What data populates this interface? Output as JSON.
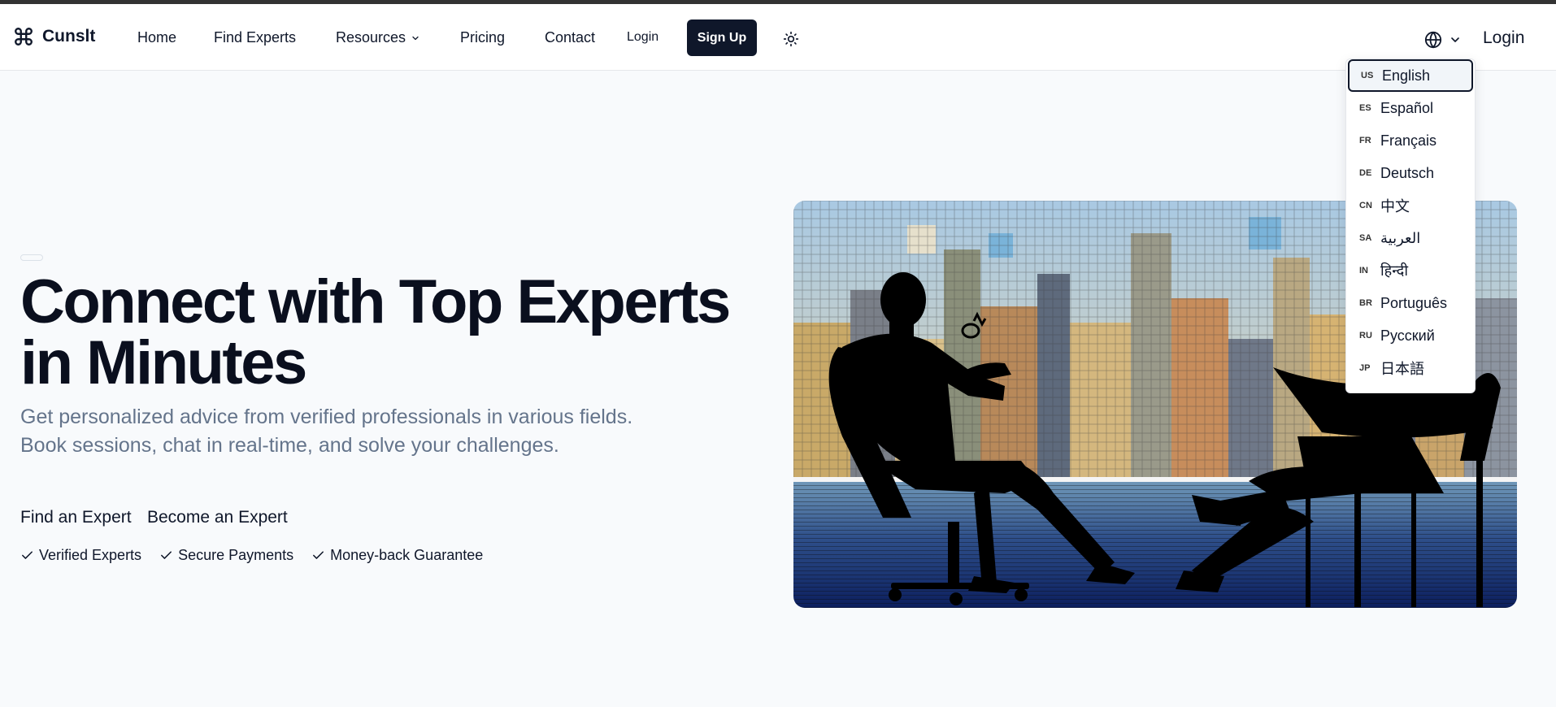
{
  "brand": {
    "name": "Cunslt",
    "logo_icon": "command-icon"
  },
  "nav": {
    "links": [
      {
        "label": "Home"
      },
      {
        "label": "Find Experts"
      },
      {
        "label": "Resources",
        "icon": "chevron-down-icon"
      },
      {
        "label": "Pricing"
      },
      {
        "label": "Contact"
      }
    ],
    "login_small": "Login",
    "signup": "Sign Up",
    "theme_icon": "sun-icon",
    "language_icon": "globe-icon",
    "login_right": "Login"
  },
  "language_menu": {
    "items": [
      {
        "code": "US",
        "label": "English",
        "selected": true
      },
      {
        "code": "ES",
        "label": "Español"
      },
      {
        "code": "FR",
        "label": "Français"
      },
      {
        "code": "DE",
        "label": "Deutsch"
      },
      {
        "code": "CN",
        "label": "中文"
      },
      {
        "code": "SA",
        "label": "العربية"
      },
      {
        "code": "IN",
        "label": "हिन्दी"
      },
      {
        "code": "BR",
        "label": "Português"
      },
      {
        "code": "RU",
        "label": "Русский"
      },
      {
        "code": "JP",
        "label": "日本語"
      }
    ]
  },
  "hero": {
    "title_line1": "Connect with Top Experts",
    "title_line2": "in Minutes",
    "subtitle": "Get personalized advice from verified professionals in various fields. Book sessions, chat in real-time, and solve your challenges.",
    "cta_primary": "Find an Expert",
    "cta_secondary": "Become an Expert",
    "features": [
      "Verified Experts",
      "Secure Payments",
      "Money-back Guarantee"
    ]
  },
  "colors": {
    "primary": "#0f172a",
    "muted_text": "#64748b",
    "background": "#f8fafc"
  }
}
